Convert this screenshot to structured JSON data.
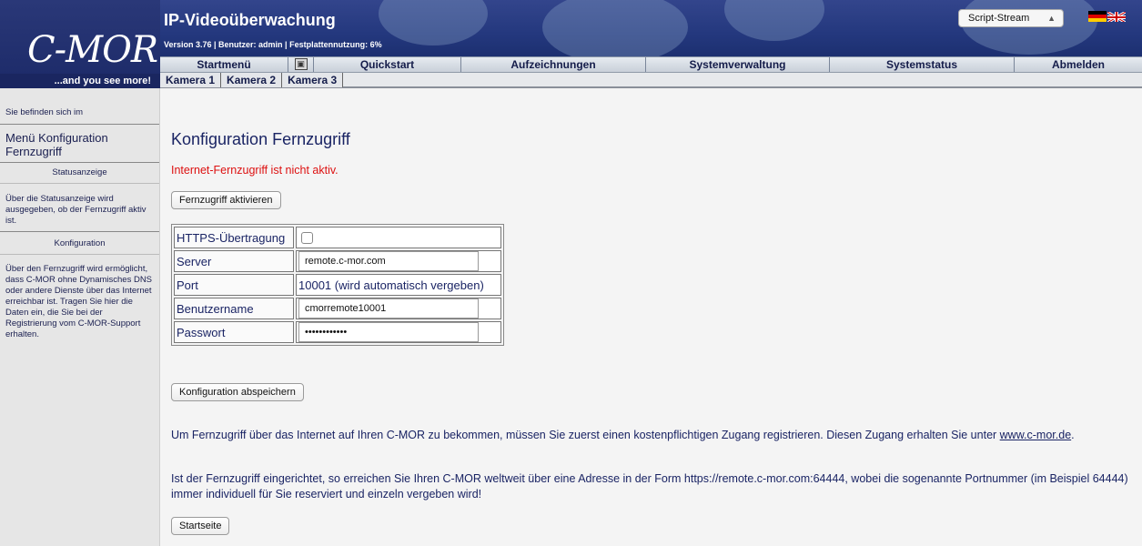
{
  "header": {
    "logo": "C-MOR",
    "slogan": "...and you see more!",
    "app_title": "IP-Videoüberwachung",
    "version_line": "Version 3.76 | Benutzer: admin | Festplattennutzung: 6%",
    "stream_select": "Script-Stream",
    "colors": {
      "header_bg": "#24387e",
      "nav_text": "#141c4a"
    }
  },
  "main_nav": {
    "items": [
      "Startmenü",
      "Quickstart",
      "Aufzeichnungen",
      "Systemverwaltung",
      "Systemstatus",
      "Abmelden"
    ]
  },
  "sub_nav": {
    "items": [
      "Kamera 1",
      "Kamera 2",
      "Kamera 3"
    ]
  },
  "sidebar": {
    "location_label": "Sie befinden sich im",
    "menu_title": "Menü Konfiguration Fernzugriff",
    "sections": [
      {
        "heading": "Statusanzeige",
        "text": "Über die Statusanzeige wird ausgegeben, ob der Fernzugriff aktiv ist."
      },
      {
        "heading": "Konfiguration",
        "text": "Über den Fernzugriff wird ermöglicht, dass C-MOR ohne Dynamisches DNS oder andere Dienste über das Internet erreichbar ist. Tragen Sie hier die Daten ein, die Sie bei der Registrierung vom C-MOR-Support erhalten."
      }
    ]
  },
  "main": {
    "title": "Konfiguration Fernzugriff",
    "status": "Internet-Fernzugriff ist nicht aktiv.",
    "status_color": "#d11111",
    "activate_button": "Fernzugriff aktivieren",
    "form": {
      "https_label": "HTTPS-Übertragung",
      "https_checked": false,
      "server_label": "Server",
      "server_value": "remote.c-mor.com",
      "port_label": "Port",
      "port_value": "10001 (wird automatisch vergeben)",
      "user_label": "Benutzername",
      "user_value": "cmorremote10001",
      "password_label": "Passwort",
      "password_value": "••••••••••••"
    },
    "save_button": "Konfiguration abspeichern",
    "para1_text": "Um Fernzugriff über das Internet auf Ihren C-MOR zu bekommen, müssen Sie zuerst einen kostenpflichtigen Zugang registrieren. Diesen Zugang erhalten Sie unter ",
    "para1_link": "www.c-mor.de",
    "para1_end": ".",
    "para2": "Ist der Fernzugriff eingerichtet, so erreichen Sie Ihren C-MOR weltweit über eine Adresse in der Form https://remote.c-mor.com:64444, wobei die sogenannte Portnummer (im Beispiel 64444) immer individuell für Sie reserviert und einzeln vergeben wird!",
    "home_button": "Startseite"
  }
}
